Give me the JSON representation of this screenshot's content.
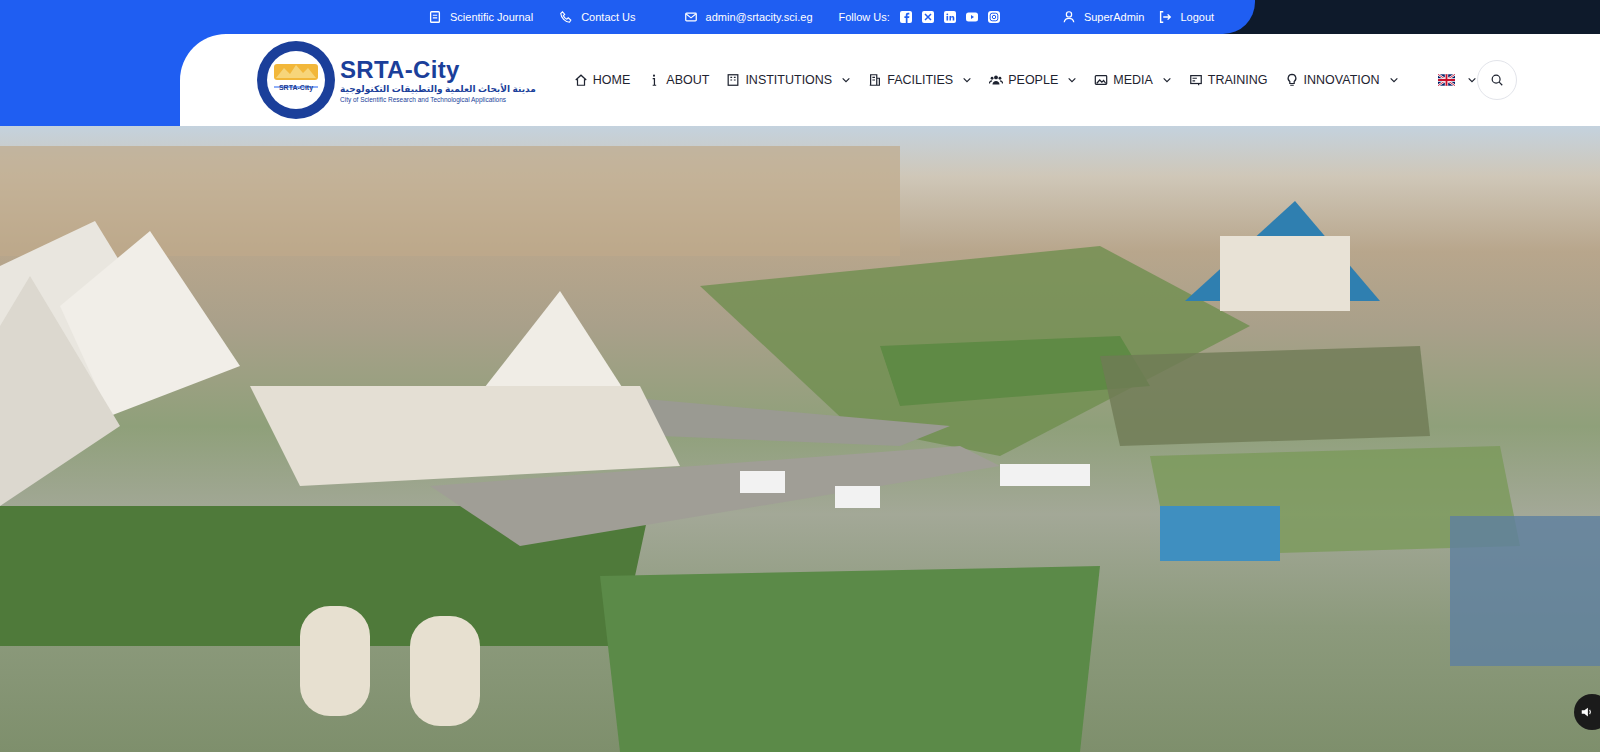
{
  "topbar": {
    "links": [
      {
        "label": "Scientific Journal"
      },
      {
        "label": "Contact Us"
      },
      {
        "label": "admin@srtacity.sci.eg"
      }
    ],
    "follow": "Follow Us:",
    "user": "SuperAdmin",
    "logout": "Logout"
  },
  "logo": {
    "title": "SRTA-City",
    "badge": "SRTA-City",
    "arabic": "مدينة الأبحاث العلمية والتطبيقات التكنولوجية",
    "english": "City of Scientific Research and Technological Applications"
  },
  "nav": [
    {
      "label": "HOME",
      "dropdown": false
    },
    {
      "label": "ABOUT",
      "dropdown": false
    },
    {
      "label": "INSTITUTIONS",
      "dropdown": true
    },
    {
      "label": "FACILITIES",
      "dropdown": true
    },
    {
      "label": "PEOPLE",
      "dropdown": true
    },
    {
      "label": "MEDIA",
      "dropdown": true
    },
    {
      "label": "TRAINING",
      "dropdown": false
    },
    {
      "label": "INNOVATION",
      "dropdown": true
    }
  ],
  "language": {
    "dropdown": true
  }
}
